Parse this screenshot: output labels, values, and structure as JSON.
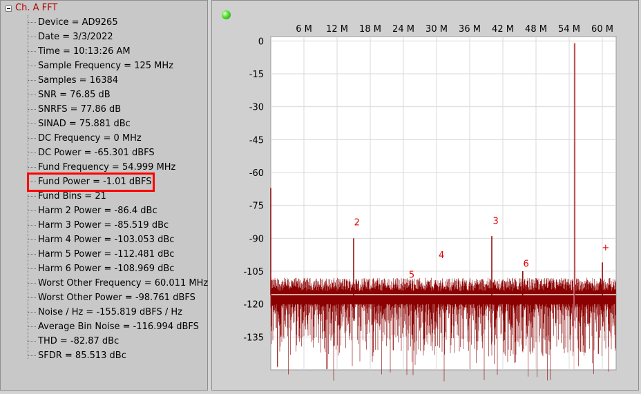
{
  "tree": {
    "root_label": "Ch. A FFT",
    "items": [
      "Device = AD9265",
      "Date = 3/3/2022",
      "Time = 10:13:26 AM",
      "Sample Frequency = 125 MHz",
      "Samples = 16384",
      "SNR = 76.85 dB",
      "SNRFS = 77.86 dB",
      "SINAD = 75.881 dBc",
      "DC Frequency = 0 MHz",
      "DC Power = -65.301 dBFS",
      "Fund Frequency = 54.999 MHz",
      "Fund Power = -1.01 dBFS",
      "Fund Bins = 21",
      "Harm 2 Power = -86.4 dBc",
      "Harm 3 Power = -85.519 dBc",
      "Harm 4 Power = -103.053 dBc",
      "Harm 5 Power = -112.481 dBc",
      "Harm 6 Power = -108.969 dBc",
      "Worst Other Frequency = 60.011 MHz",
      "Worst Other Power = -98.761 dBFS",
      "Noise / Hz = -155.819 dBFS / Hz",
      "Average Bin Noise = -116.994 dBFS",
      "THD = -82.87 dBc",
      "SFDR = 85.513 dBc"
    ],
    "highlighted_index": 11
  },
  "status_led": {
    "color": "#3fd021",
    "icon": "status-led-icon"
  },
  "colors": {
    "trace": "#8b0000",
    "marker": "#e00000",
    "highlight": "#ff0000",
    "tree_root": "#b00000"
  },
  "chart_data": {
    "type": "line",
    "x_ticks": [
      "6 M",
      "12 M",
      "18 M",
      "24 M",
      "30 M",
      "36 M",
      "42 M",
      "48 M",
      "54 M",
      "60 M"
    ],
    "x_tick_values_mhz": [
      6,
      12,
      18,
      24,
      30,
      36,
      42,
      48,
      54,
      60
    ],
    "y_ticks": [
      "0",
      "-15",
      "-30",
      "-45",
      "-60",
      "-75",
      "-90",
      "-105",
      "-120",
      "-135"
    ],
    "y_tick_values": [
      0,
      -15,
      -30,
      -45,
      -60,
      -75,
      -90,
      -105,
      -120,
      -135
    ],
    "xlim": [
      0,
      62.5
    ],
    "ylim": [
      -150,
      2
    ],
    "x_axis_position": "top",
    "grid": true,
    "noise_floor_dbfs": -116,
    "peaks": [
      {
        "x": 0,
        "y": -67
      },
      {
        "x": 54.999,
        "y": -1.01
      },
      {
        "x": 15.0,
        "y": -90
      },
      {
        "x": 40.0,
        "y": -89
      },
      {
        "x": 45.6,
        "y": -105
      },
      {
        "x": 60.011,
        "y": -101
      }
    ],
    "markers": [
      {
        "text": "2",
        "x": 15.6,
        "y": -84
      },
      {
        "text": "3",
        "x": 40.7,
        "y": -83.5
      },
      {
        "text": "4",
        "x": 30.9,
        "y": -99
      },
      {
        "text": "5",
        "x": 25.5,
        "y": -108
      },
      {
        "text": "6",
        "x": 46.2,
        "y": -103
      },
      {
        "text": "+",
        "x": 60.6,
        "y": -95.5
      }
    ]
  }
}
